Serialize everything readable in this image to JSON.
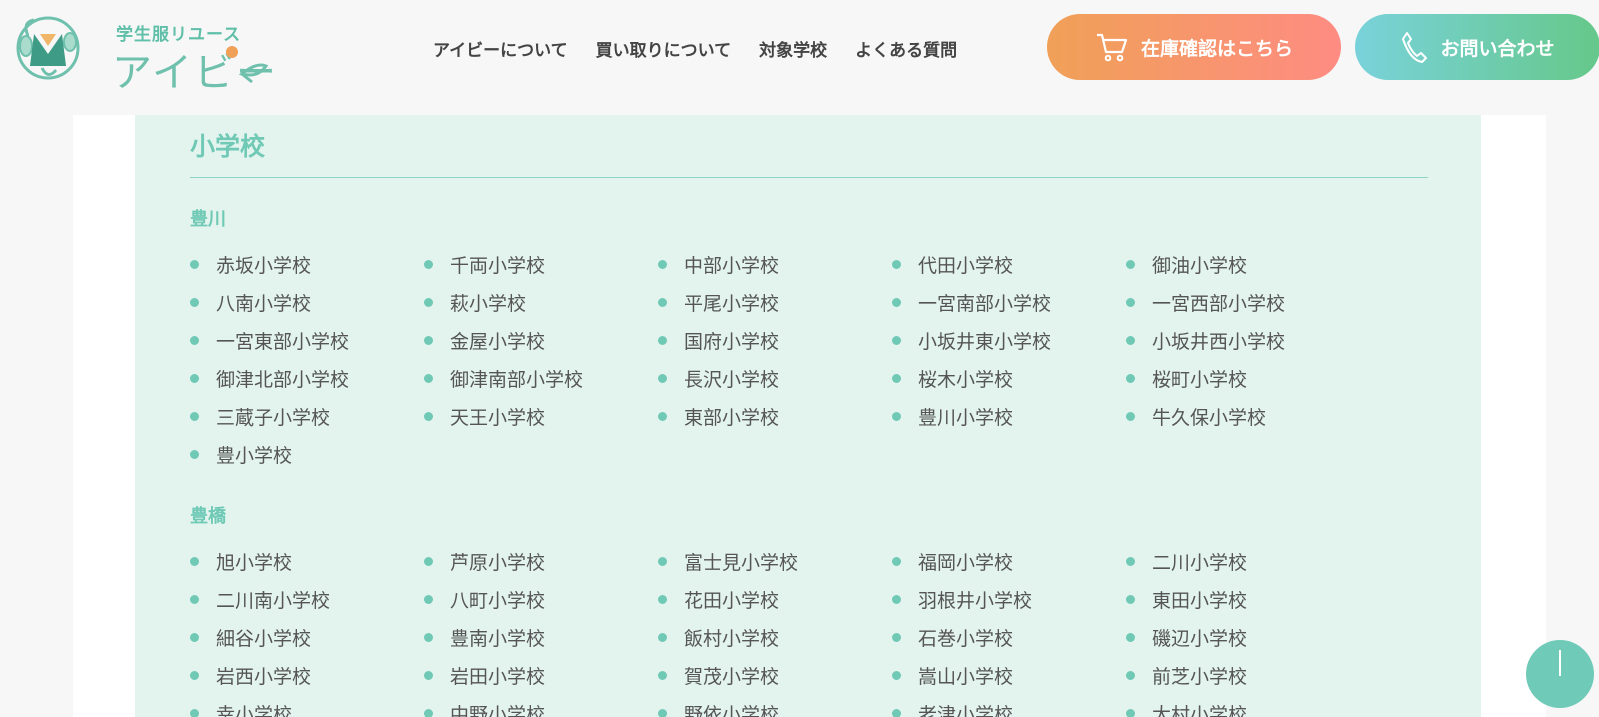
{
  "header": {
    "logo_sub": "学生服リユース",
    "logo_main": "アイビー",
    "nav": [
      "アイビーについて",
      "買い取りについて",
      "対象学校",
      "よくある質問"
    ],
    "stock_button": "在庫確認はこちら",
    "contact_button": "お問い合わせ"
  },
  "section": {
    "title": "小学校",
    "regions": [
      {
        "name": "豊川",
        "schools": [
          "赤坂小学校",
          "千両小学校",
          "中部小学校",
          "代田小学校",
          "御油小学校",
          "八南小学校",
          "萩小学校",
          "平尾小学校",
          "一宮南部小学校",
          "一宮西部小学校",
          "一宮東部小学校",
          "金屋小学校",
          "国府小学校",
          "小坂井東小学校",
          "小坂井西小学校",
          "御津北部小学校",
          "御津南部小学校",
          "長沢小学校",
          "桜木小学校",
          "桜町小学校",
          "三蔵子小学校",
          "天王小学校",
          "東部小学校",
          "豊川小学校",
          "牛久保小学校",
          "豊小学校"
        ]
      },
      {
        "name": "豊橋",
        "schools": [
          "旭小学校",
          "芦原小学校",
          "富士見小学校",
          "福岡小学校",
          "二川小学校",
          "二川南小学校",
          "八町小学校",
          "花田小学校",
          "羽根井小学校",
          "東田小学校",
          "細谷小学校",
          "豊南小学校",
          "飯村小学校",
          "石巻小学校",
          "磯辺小学校",
          "岩西小学校",
          "岩田小学校",
          "賀茂小学校",
          "嵩山小学校",
          "前芝小学校",
          "幸小学校",
          "中野小学校",
          "野依小学校",
          "老津小学校",
          "大村小学校"
        ]
      }
    ]
  },
  "colors": {
    "accent": "#6fc9b5",
    "panel_bg": "#e3f4ef",
    "stock_gradient": [
      "#f0a057",
      "#fe8c82"
    ],
    "contact_gradient": [
      "#79d2da",
      "#66c88a"
    ]
  },
  "icons": {
    "stock": "cart-icon",
    "contact": "phone-icon",
    "scroll_top": "scroll-top-icon"
  }
}
